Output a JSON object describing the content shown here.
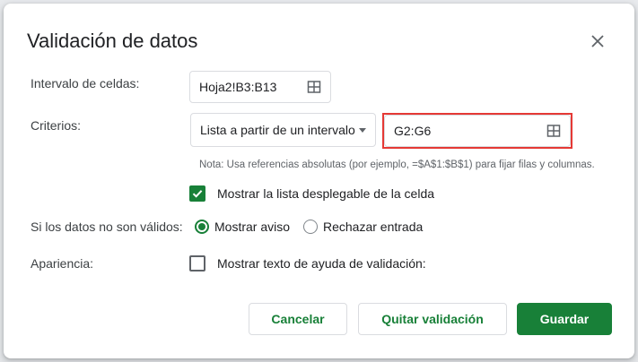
{
  "dialog": {
    "title": "Validación de datos",
    "close_icon": "close-icon"
  },
  "range": {
    "label": "Intervalo de celdas:",
    "value": "Hoja2!B3:B13",
    "icon": "grid-icon"
  },
  "criteria": {
    "label": "Criterios:",
    "type_value": "Lista a partir de un intervalo",
    "range_value": "G2:G6",
    "note": "Nota: Usa referencias absolutas (por ejemplo, =$A$1:$B$1) para fijar filas y columnas."
  },
  "dropdown_option": {
    "label": "Mostrar la lista desplegable de la celda",
    "checked": true
  },
  "invalid": {
    "label": "Si los datos no son válidos:",
    "options": [
      {
        "label": "Mostrar aviso",
        "selected": true
      },
      {
        "label": "Rechazar entrada",
        "selected": false
      }
    ]
  },
  "appearance": {
    "label": "Apariencia:",
    "help_label": "Mostrar texto de ayuda de validación:",
    "checked": false
  },
  "buttons": {
    "cancel": "Cancelar",
    "remove": "Quitar validación",
    "save": "Guardar"
  },
  "colors": {
    "accent": "#188038",
    "highlight": "#e53935"
  }
}
